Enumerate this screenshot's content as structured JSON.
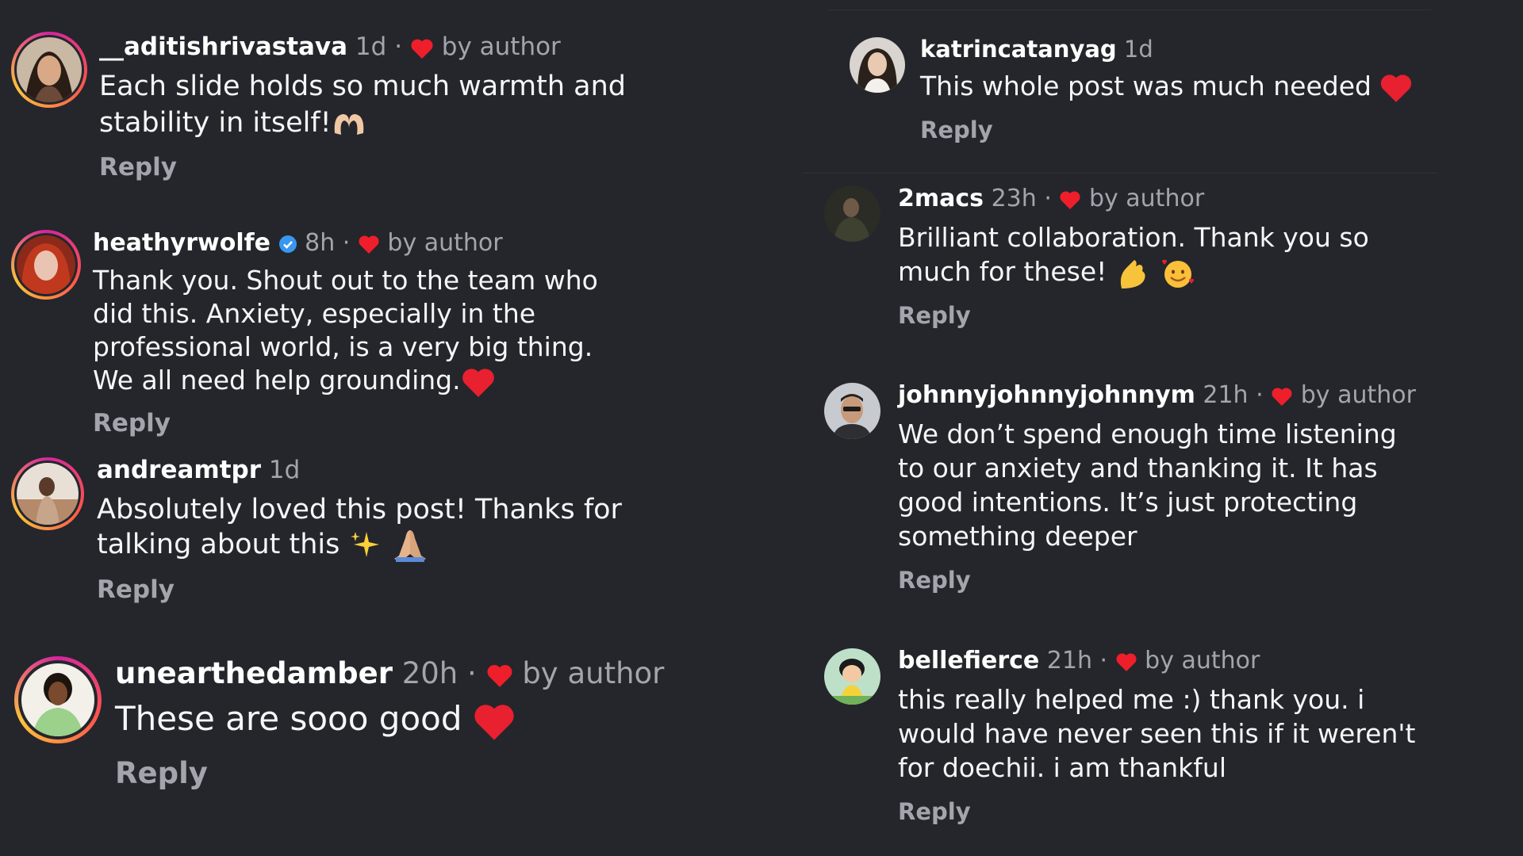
{
  "colors": {
    "background": "#24262b",
    "text": "#f5f6f8",
    "muted": "#a2a5ac",
    "heart": "#ef1e2b",
    "verified": "#3897f0"
  },
  "comments": [
    {
      "username": "__aditishrivastava",
      "time": "1d",
      "separator": "·",
      "author_badge": "by author",
      "lines": [
        "Each slide holds so much warmth and",
        "stability in itself!"
      ],
      "emoji": [
        "heart-hands-icon"
      ],
      "reply": "Reply"
    },
    {
      "username": "heathyrwolfe",
      "verified": true,
      "time": "8h",
      "separator": "·",
      "author_badge": "by author",
      "lines": [
        "Thank you. Shout out to the team who",
        "did this. Anxiety, especially in the",
        "professional world, is a very big thing.",
        "We all need help grounding."
      ],
      "emoji": [
        "red-heart-icon"
      ],
      "reply": "Reply"
    },
    {
      "username": "andreamtpr",
      "time": "1d",
      "lines": [
        "Absolutely loved this post! Thanks for",
        "talking about this"
      ],
      "emoji": [
        "sparkles-icon",
        "folded-hands-icon"
      ],
      "reply": "Reply"
    },
    {
      "username": "unearthedamber",
      "time": "20h",
      "separator": "·",
      "author_badge": "by author",
      "lines": [
        "These are sooo good"
      ],
      "emoji": [
        "red-heart-icon"
      ],
      "reply": "Reply"
    },
    {
      "username": "katrincatanyag",
      "time": "1d",
      "lines": [
        "This whole post was much needed"
      ],
      "emoji": [
        "red-heart-icon"
      ],
      "reply": "Reply"
    },
    {
      "username": "2macs",
      "time": "23h",
      "separator": "·",
      "author_badge": "by author",
      "lines": [
        "Brilliant collaboration. Thank you so",
        "much for these!"
      ],
      "emoji": [
        "pinching-hand-icon",
        "smiling-face-with-hearts-icon"
      ],
      "reply": "Reply"
    },
    {
      "username": "johnnyjohnnyjohnnym",
      "time": "21h",
      "separator": "·",
      "author_badge": "by author",
      "lines": [
        "We don’t spend enough time listening",
        "to our anxiety and thanking it. It has",
        "good intentions. It’s just protecting",
        "something deeper"
      ],
      "reply": "Reply"
    },
    {
      "username": "bellefierce",
      "time": "21h",
      "separator": "·",
      "author_badge": "by author",
      "lines": [
        "this really helped me :) thank you. i",
        "would have never seen this if it weren't",
        "for doechii. i am thankful"
      ],
      "reply": "Reply"
    }
  ]
}
